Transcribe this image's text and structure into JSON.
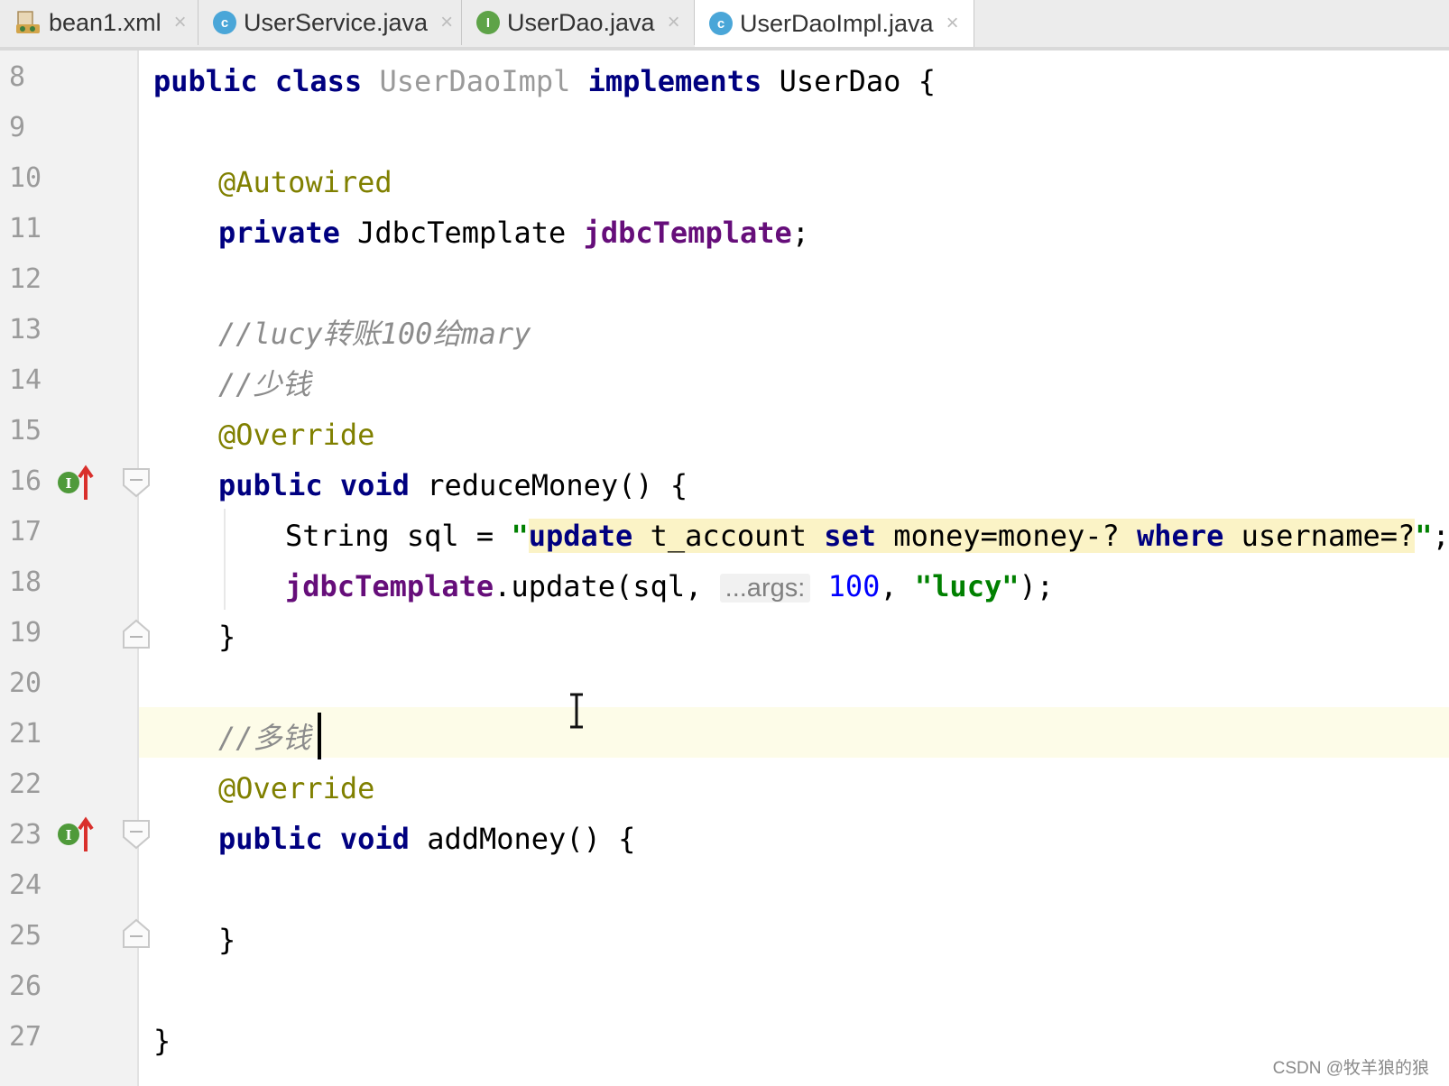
{
  "tabs": [
    {
      "label": "bean1.xml",
      "icon": "xml-file-icon",
      "active": false
    },
    {
      "label": "UserService.java",
      "icon": "class-icon",
      "active": false
    },
    {
      "label": "UserDao.java",
      "icon": "interface-icon",
      "active": false
    },
    {
      "label": "UserDaoImpl.java",
      "icon": "class-icon",
      "active": true
    }
  ],
  "tab_icon_letters": {
    "class": "c",
    "interface": "I"
  },
  "close_glyph": "×",
  "line_numbers": [
    "8",
    "9",
    "10",
    "11",
    "12",
    "13",
    "14",
    "15",
    "16",
    "17",
    "18",
    "19",
    "20",
    "21",
    "22",
    "23",
    "24",
    "25",
    "26",
    "27"
  ],
  "code": {
    "l8": {
      "kw1": "public",
      "kw2": "class",
      "name": "UserDaoImpl",
      "kw3": "implements",
      "iface": "UserDao",
      "brace": "{"
    },
    "l10": {
      "annotation": "@Autowired"
    },
    "l11": {
      "kw": "private",
      "type": "JdbcTemplate",
      "field": "jdbcTemplate",
      "semi": ";"
    },
    "l13": {
      "comment": "//lucy转账100给mary"
    },
    "l14": {
      "comment": "//少钱"
    },
    "l15": {
      "annotation": "@Override"
    },
    "l16": {
      "kw1": "public",
      "kw2": "void",
      "method": "reduceMoney()",
      "brace": "{"
    },
    "l17": {
      "decl": "String sql = ",
      "quote_open": "\"",
      "s1": "update",
      "s2": " t_account ",
      "s3": "set",
      "s4": " money=money-? ",
      "s5": "where",
      "s6": " username=?",
      "quote_close": "\"",
      "semi": ";"
    },
    "l18": {
      "field": "jdbcTemplate",
      "call": ".update(sql, ",
      "hint": "...args:",
      "num": "100",
      "sep": ", ",
      "str": "\"lucy\"",
      "end": ");"
    },
    "l19": {
      "brace": "}"
    },
    "l21": {
      "comment": "//多钱"
    },
    "l22": {
      "annotation": "@Override"
    },
    "l23": {
      "kw1": "public",
      "kw2": "void",
      "method": "addMoney()",
      "brace": "{"
    },
    "l25": {
      "brace": "}"
    },
    "l27": {
      "brace": "}"
    }
  },
  "gutter_marker_letter": "I",
  "watermark": "CSDN @牧羊狼的狼",
  "colors": {
    "keyword": "#000080",
    "annotation": "#808000",
    "field": "#660e7a",
    "comment": "#8c8c8c",
    "string": "#008000",
    "number": "#0000ff",
    "caret_line": "#fdfce8",
    "sql_highlight": "#fbf3c6"
  }
}
